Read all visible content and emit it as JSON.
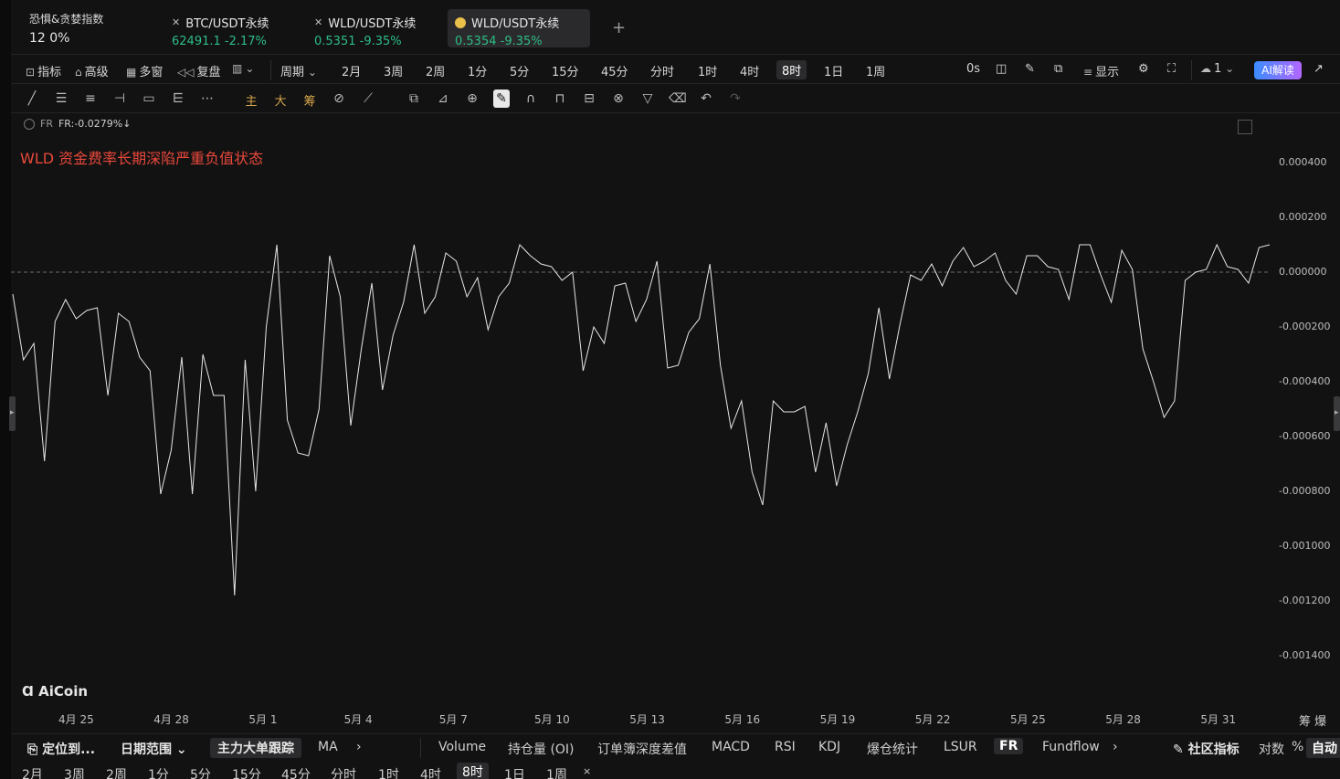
{
  "fear_greed": {
    "title": "恐惧&贪婪指数",
    "value": "12 0%"
  },
  "tabs": [
    {
      "name": "BTC/USDT永续",
      "price": "62491.1",
      "change": "-2.17%"
    },
    {
      "name": "WLD/USDT永续",
      "price": "0.5351",
      "change": "-9.35%"
    },
    {
      "name": "WLD/USDT永续",
      "price": "0.5354",
      "change": "-9.35%",
      "active": true
    }
  ],
  "toolbar": {
    "indicator": "指标",
    "advanced": "高级",
    "multi_window": "多窗",
    "replay": "复盘",
    "period": "周期",
    "periods": [
      "2月",
      "3周",
      "2周",
      "1分",
      "5分",
      "15分",
      "45分",
      "分时",
      "1时",
      "4时",
      "8时",
      "1日",
      "1周"
    ],
    "selected_period": "8时",
    "countdown": "0s",
    "display": "显示",
    "layer_count": "1",
    "ai": "AI解读"
  },
  "draw_toolbar": {
    "main": "主",
    "big": "大",
    "chip": "筹"
  },
  "indicator_label": {
    "name": "FR",
    "value": "FR:-0.0279%↓"
  },
  "annotation": "WLD 资金费率长期深陷严重负值状态",
  "chart_data": {
    "type": "line",
    "title": "",
    "ylabel": "",
    "ylim": [
      -0.0015,
      0.00045
    ],
    "y_ticks": [
      "0.000400",
      "0.000200",
      "0.000000",
      "-0.000200",
      "-0.000400",
      "-0.000600",
      "-0.000800",
      "-0.001000",
      "-0.001200",
      "-0.001400"
    ],
    "x_ticks": [
      "4月 25",
      "4月 28",
      "5月 1",
      "5月 4",
      "5月 7",
      "5月 10",
      "5月 13",
      "5月 16",
      "5月 19",
      "5月 22",
      "5月 25",
      "5月 28",
      "5月 31"
    ],
    "reference_line": 0,
    "series": [
      {
        "values": [
          -8e-05,
          -0.00032,
          -0.00026,
          -0.00069,
          -0.00018,
          -0.0001,
          -0.00017,
          -0.00014,
          -0.00013,
          -0.00045,
          -0.00015,
          -0.00018,
          -0.00031,
          -0.00036,
          -0.00081,
          -0.00065,
          -0.00031,
          -0.00081,
          -0.0003,
          -0.00045,
          -0.00045,
          -0.00118,
          -0.00032,
          -0.0008,
          -0.0002,
          0.0001,
          -0.00054,
          -0.00066,
          -0.00067,
          -0.0005,
          6e-05,
          -9e-05,
          -0.00056,
          -0.00028,
          -4e-05,
          -0.00043,
          -0.00023,
          -0.00011,
          0.0001,
          -0.00015,
          -9e-05,
          7e-05,
          4e-05,
          -9e-05,
          -2e-05,
          -0.00021,
          -9e-05,
          -4e-05,
          0.0001,
          6e-05,
          3e-05,
          2e-05,
          -3e-05,
          0,
          -0.00036,
          -0.0002,
          -0.00026,
          -5e-05,
          -4e-05,
          -0.00018,
          -0.0001,
          4e-05,
          -0.00035,
          -0.00034,
          -0.00022,
          -0.00017,
          3e-05,
          -0.00034,
          -0.00057,
          -0.00047,
          -0.00073,
          -0.00085,
          -0.00047,
          -0.00051,
          -0.00051,
          -0.00049,
          -0.00073,
          -0.00055,
          -0.00078,
          -0.00063,
          -0.00051,
          -0.00037,
          -0.00013,
          -0.00039,
          -0.00019,
          -1e-05,
          -3e-05,
          3e-05,
          -5e-05,
          4e-05,
          9e-05,
          2e-05,
          4e-05,
          7e-05,
          -3e-05,
          -8e-05,
          6e-05,
          6e-05,
          2e-05,
          1e-05,
          -0.0001,
          0.0001,
          0.0001,
          -1e-05,
          -0.00011,
          8e-05,
          1e-05,
          -0.00028,
          -0.0004,
          -0.00053,
          -0.00047,
          -3e-05,
          0,
          1e-05,
          0.0001,
          2e-05,
          1e-05,
          -4e-05,
          9e-05,
          0.0001
        ]
      }
    ]
  },
  "logo": "AiCoin",
  "chart_corner": {
    "chip": "筹",
    "liq": "爆"
  },
  "bottom": {
    "locate": "定位到...",
    "date_range": "日期范围",
    "main_force": "主力大单跟踪",
    "ma": "MA",
    "indicators": [
      "Volume",
      "持仓量 (OI)",
      "订单簿深度差值",
      "MACD",
      "RSI",
      "KDJ",
      "爆仓统计",
      "LSUR",
      "FR",
      "Fundflow"
    ],
    "selected_indicator": "FR",
    "community": "社区指标",
    "log": "对数",
    "percent": "%",
    "auto": "自动"
  },
  "bottom2": {
    "periods": [
      "2月",
      "3周",
      "2周",
      "1分",
      "5分",
      "15分",
      "45分",
      "分时",
      "1时",
      "4时",
      "8时",
      "1日",
      "1周"
    ],
    "selected": "8时"
  }
}
